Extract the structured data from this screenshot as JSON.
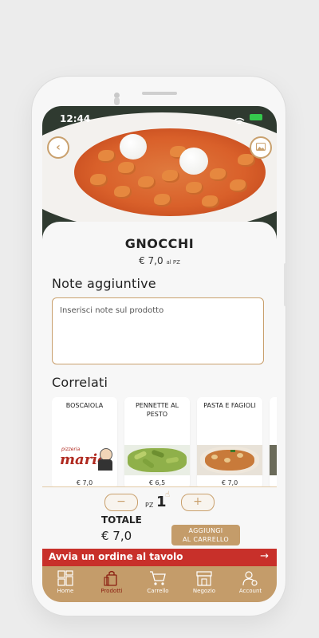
{
  "status_bar": {
    "time": "12:44"
  },
  "product": {
    "name": "GNOCCHI",
    "price": "€ 7,0",
    "price_unit": "al PZ"
  },
  "notes": {
    "heading": "Note aggiuntive",
    "placeholder": "Inserisci note sul prodotto"
  },
  "related": {
    "heading": "Correlati",
    "items": [
      {
        "name": "BOSCAIOLA",
        "price": "€ 7,0"
      },
      {
        "name": "PENNETTE AL PESTO",
        "price": "€ 6,5"
      },
      {
        "name": "PASTA E FAGIOLI",
        "price": "€ 7,0"
      }
    ]
  },
  "logo_text": {
    "top": "pizzeria",
    "main": "mario"
  },
  "quantity": {
    "minus": "−",
    "plus": "+",
    "unit": "PZ",
    "value": "1"
  },
  "total": {
    "label": "TOTALE",
    "value": "€ 7,0"
  },
  "add_button": {
    "line1": "AGGIUNGI",
    "line2": "AL CARRELLO"
  },
  "order_banner": {
    "text": "Avvia un ordine al tavolo",
    "arrow": "→"
  },
  "tabs": [
    {
      "label": "Home",
      "icon": "home-grid-icon",
      "active": false
    },
    {
      "label": "Prodotti",
      "icon": "bag-icon",
      "active": true
    },
    {
      "label": "Carrello",
      "icon": "cart-icon",
      "active": false
    },
    {
      "label": "Negozio",
      "icon": "store-icon",
      "active": false
    },
    {
      "label": "Account",
      "icon": "account-gear-icon",
      "active": false
    }
  ],
  "colors": {
    "accent": "#c49c6a",
    "banner": "#c8302a",
    "active_tab": "#8b1e12"
  }
}
